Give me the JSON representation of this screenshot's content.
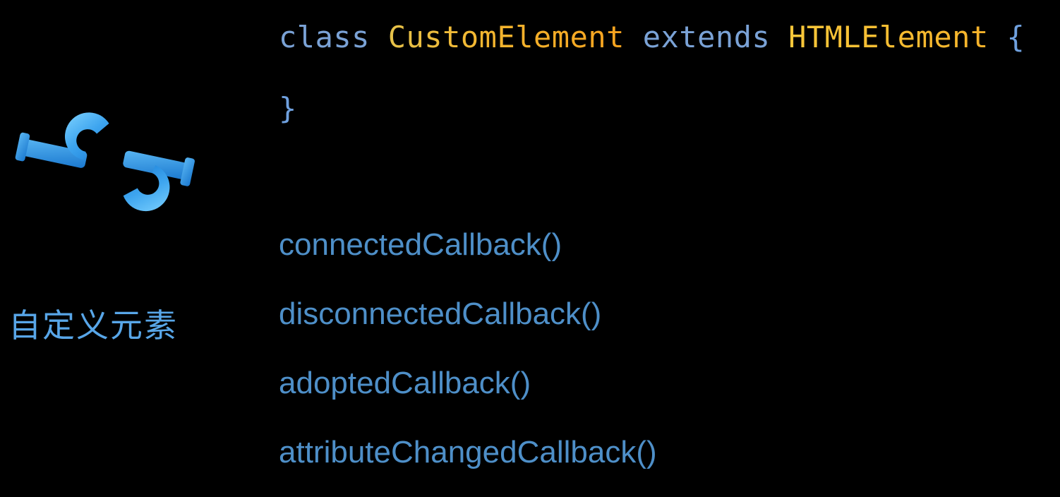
{
  "side": {
    "label": "自定义元素",
    "icon": "wrench-link-icon"
  },
  "code": {
    "keyword_class": "class",
    "class_name": "CustomElement",
    "keyword_extends": "extends",
    "parent_class": "HTMLElement",
    "open_brace": "{",
    "close_brace": "}"
  },
  "callbacks": [
    "connectedCallback()",
    "disconnectedCallback()",
    "adoptedCallback()",
    "attributeChangedCallback()"
  ]
}
